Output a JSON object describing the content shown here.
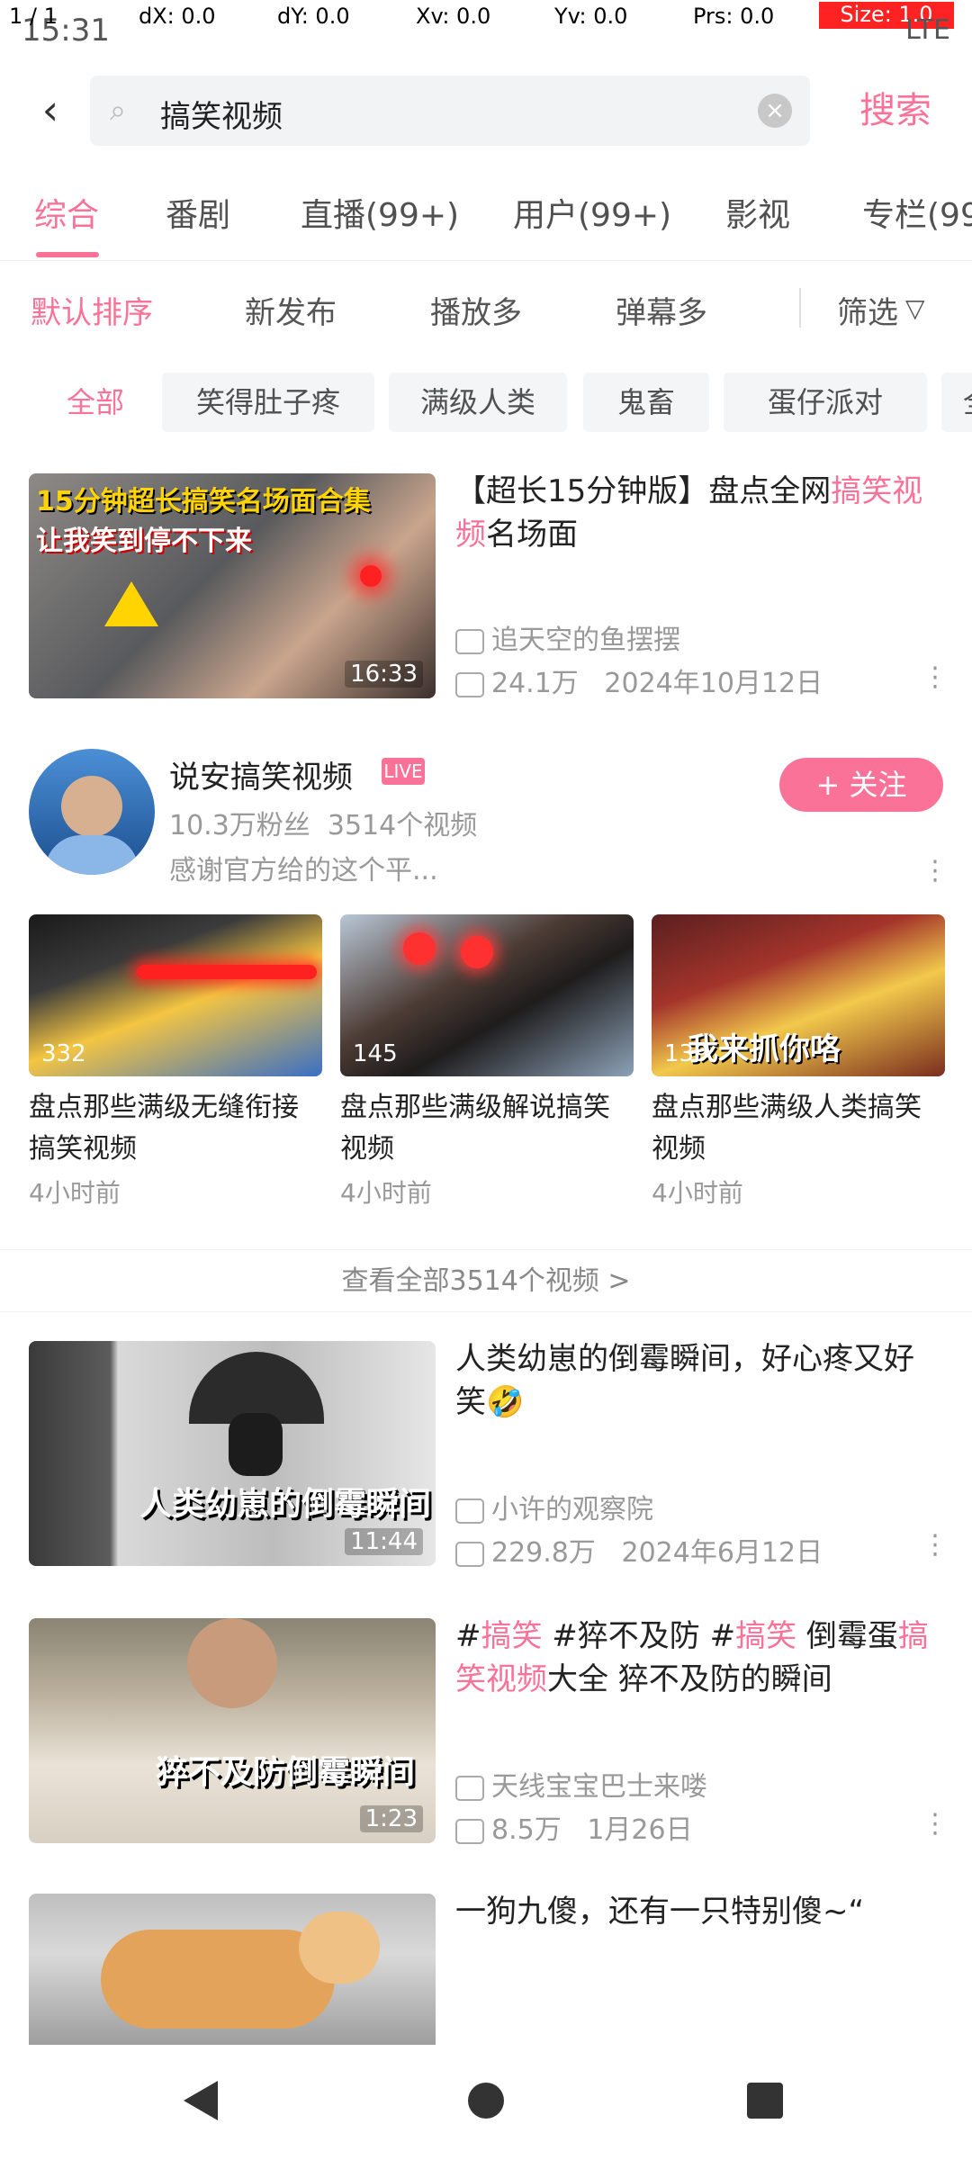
{
  "status": {
    "time": "15:31",
    "pointer": "1 / 1",
    "dx": "dX: 0.0",
    "dy": "dY: 0.0",
    "xv": "Xv: 0.0",
    "yv": "Yv: 0.0",
    "prs": "Prs: 0.0",
    "size": "Size: 1.0",
    "network": "LTE"
  },
  "search": {
    "query": "搞笑视频",
    "button": "搜索"
  },
  "tabs": [
    {
      "label": "综合"
    },
    {
      "label": "番剧"
    },
    {
      "label": "直播(99+)"
    },
    {
      "label": "用户(99+)"
    },
    {
      "label": "影视"
    },
    {
      "label": "专栏(99"
    }
  ],
  "sort": {
    "items": [
      {
        "label": "默认排序"
      },
      {
        "label": "新发布"
      },
      {
        "label": "播放多"
      },
      {
        "label": "弹幕多"
      }
    ],
    "filter": "筛选"
  },
  "chips": [
    {
      "label": "全部"
    },
    {
      "label": "笑得肚子疼"
    },
    {
      "label": "满级人类"
    },
    {
      "label": "鬼畜"
    },
    {
      "label": "蛋仔派对"
    },
    {
      "label": "全"
    }
  ],
  "videos": [
    {
      "thumb_caption_top": "15分钟超长搞笑名场面合集",
      "thumb_caption_sub": "让我笑到停不下来",
      "duration": "16:33",
      "title_pre": "【超长15分钟版】盘点全网",
      "title_hl": "搞笑视频",
      "title_post": "名场面",
      "author": "追天空的鱼摆摆",
      "views": "24.1万",
      "date": "2024年10月12日"
    }
  ],
  "user": {
    "name": "说安搞笑视频",
    "badge": "LIVE",
    "fans": "10.3万粉丝",
    "video_count": "3514个视频",
    "desc": "感谢官方给的这个平...",
    "follow": "+ 关注",
    "videos": [
      {
        "plays": "332",
        "title": "盘点那些满级无缝衔接搞笑视频",
        "time": "4小时前"
      },
      {
        "plays": "145",
        "title": "盘点那些满级解说搞笑视频",
        "time": "4小时前"
      },
      {
        "plays": "139",
        "title": "盘点那些满级人类搞笑视频",
        "time": "4小时前",
        "caption": "我来抓你咯"
      }
    ],
    "see_all": "查看全部3514个视频 >"
  },
  "videos2": [
    {
      "thumb_caption": "人类幼崽的倒霉瞬间",
      "duration": "11:44",
      "title": "人类幼崽的倒霉瞬间，好心疼又好笑🤣",
      "author": "小许的观察院",
      "views": "229.8万",
      "date": "2024年6月12日"
    },
    {
      "thumb_caption": "猝不及防倒霉瞬间",
      "duration": "1:23",
      "title_parts": [
        "#",
        "搞笑",
        " #猝不及防 #",
        "搞笑",
        " 倒霉蛋",
        "搞笑视频",
        "大全 猝不及防的瞬间"
      ],
      "author": "天线宝宝巴士来喽",
      "views": "8.5万",
      "date": "1月26日"
    },
    {
      "title": "一狗九傻，还有一只特别傻~“"
    }
  ]
}
